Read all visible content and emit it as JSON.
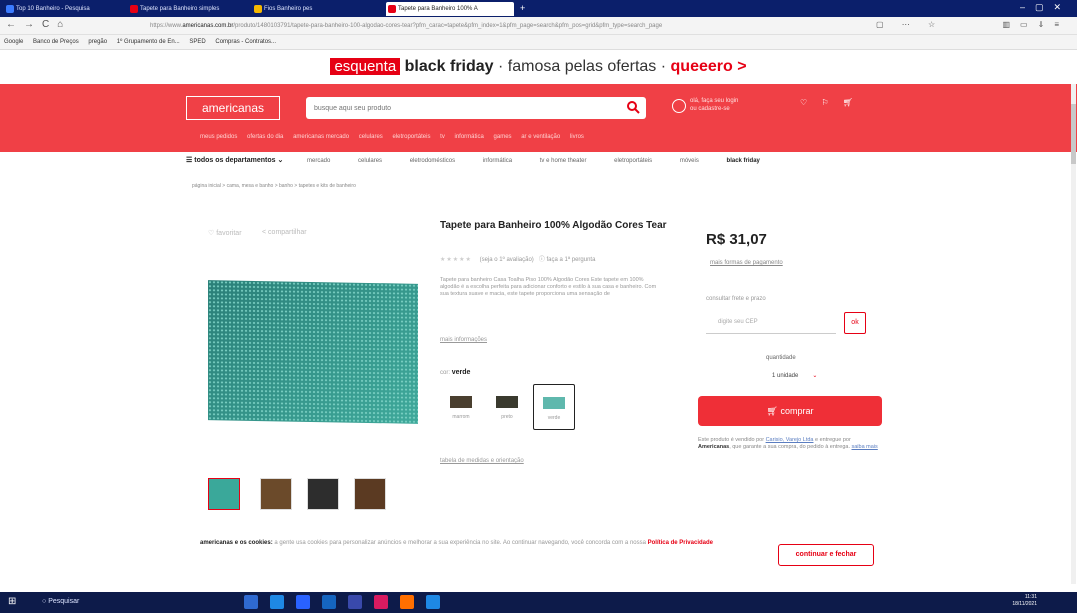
{
  "tabs": [
    {
      "label": "Top 10 Banheiro - Pesquisa"
    },
    {
      "label": "Tapete para Banheiro simples"
    },
    {
      "label": "Fios Banheiro pes"
    },
    {
      "label": "Tapete para Banheiro 100% A"
    }
  ],
  "address": {
    "url_pre": "https://www.",
    "url_domain": "americanas.com.br",
    "url_rest": "/produto/1480103791/tapete-para-banheiro-100-algodao-cores-tear?pfm_carac=tapete&pfm_index=1&pfm_page=search&pfm_pos=grid&pfm_type=search_page"
  },
  "bookmarks": [
    "Google",
    "Banco de Preços",
    "pregão",
    "1º Grupamento de En...",
    "SPED",
    "Compras - Contratos..."
  ],
  "promo": {
    "badge": "esquenta",
    "bf": "black friday",
    "middle": " · famosa pelas ofertas · ",
    "cta": "queeero >"
  },
  "header": {
    "logo": "americanas",
    "search_placeholder": "busque aqui seu produto",
    "loc_line1": "olá, faça seu login",
    "loc_line2": "ou cadastre-se",
    "submenu": [
      "meus pedidos",
      "ofertas do dia",
      "americanas mercado",
      "celulares",
      "eletroportáteis",
      "tv",
      "informática",
      "games",
      "ar e ventilação",
      "livros"
    ]
  },
  "deptnav": {
    "all": "todos os departamentos",
    "items": [
      "mercado",
      "celulares",
      "eletrodomésticos",
      "informática",
      "tv e home theater",
      "eletroportáteis",
      "móveis"
    ],
    "bf": "black friday"
  },
  "breadcrumb": "página inicial  >  cama, mesa e banho  >  banho  >  tapetes e kits de banheiro",
  "product": {
    "fav": "favoritar",
    "share": "compartilhar",
    "title": "Tapete para Banheiro 100% Algodão Cores Tear",
    "stars": "★★★★★",
    "rating_text": "(seja o 1º avaliação)",
    "question_text": "faça a 1ª pergunta",
    "description": "Tapete para banheiro Casa Toalha Piso 100% Algodão Cores Este tapete em 100% algodão é a escolha perfeita para adicionar conforto e estilo à sua casa e banheiro. Com sua textura suave e macia, este tapete proporciona uma sensação de",
    "more_info": "mais informações",
    "color_label": "cor:",
    "color_value": "verde",
    "swatches": [
      {
        "label": "marrom"
      },
      {
        "label": "preto"
      },
      {
        "label": "verde"
      }
    ],
    "size_table": "tabela de medidas e orientação",
    "thumbnails": 4
  },
  "buy": {
    "price": "R$ 31,07",
    "payment": "mais formas de pagamento",
    "cep_label": "consultar frete e prazo",
    "cep_placeholder": "digite seu CEP",
    "ok": "ok",
    "qty_label": "quantidade",
    "qty_value": "1 unidade",
    "buy_label": "comprar",
    "seller_pre": "Este produto é vendido por ",
    "seller_name": "Carisio, Varejo Ltda",
    "seller_mid": " e entregue por ",
    "seller_company": "Americanas",
    "seller_post": ", que garante a sua compra, do pedido à entrega. ",
    "seller_link": "saiba mais"
  },
  "cookie": {
    "brand": "americanas e os cookies:",
    "text": " a gente usa cookies para personalizar anúncios e melhorar a sua experiência no site. Ao continuar navegando, você concorda com a nossa ",
    "policy": "Política de Privacidade",
    "button": "continuar e fechar"
  },
  "taskbar": {
    "search": "Pesquisar",
    "time": "11:31",
    "date": "18/11/2021"
  },
  "colors": {
    "brand": "#f04046",
    "accent": "#e60014",
    "taskbar": "#0d1b4a"
  }
}
